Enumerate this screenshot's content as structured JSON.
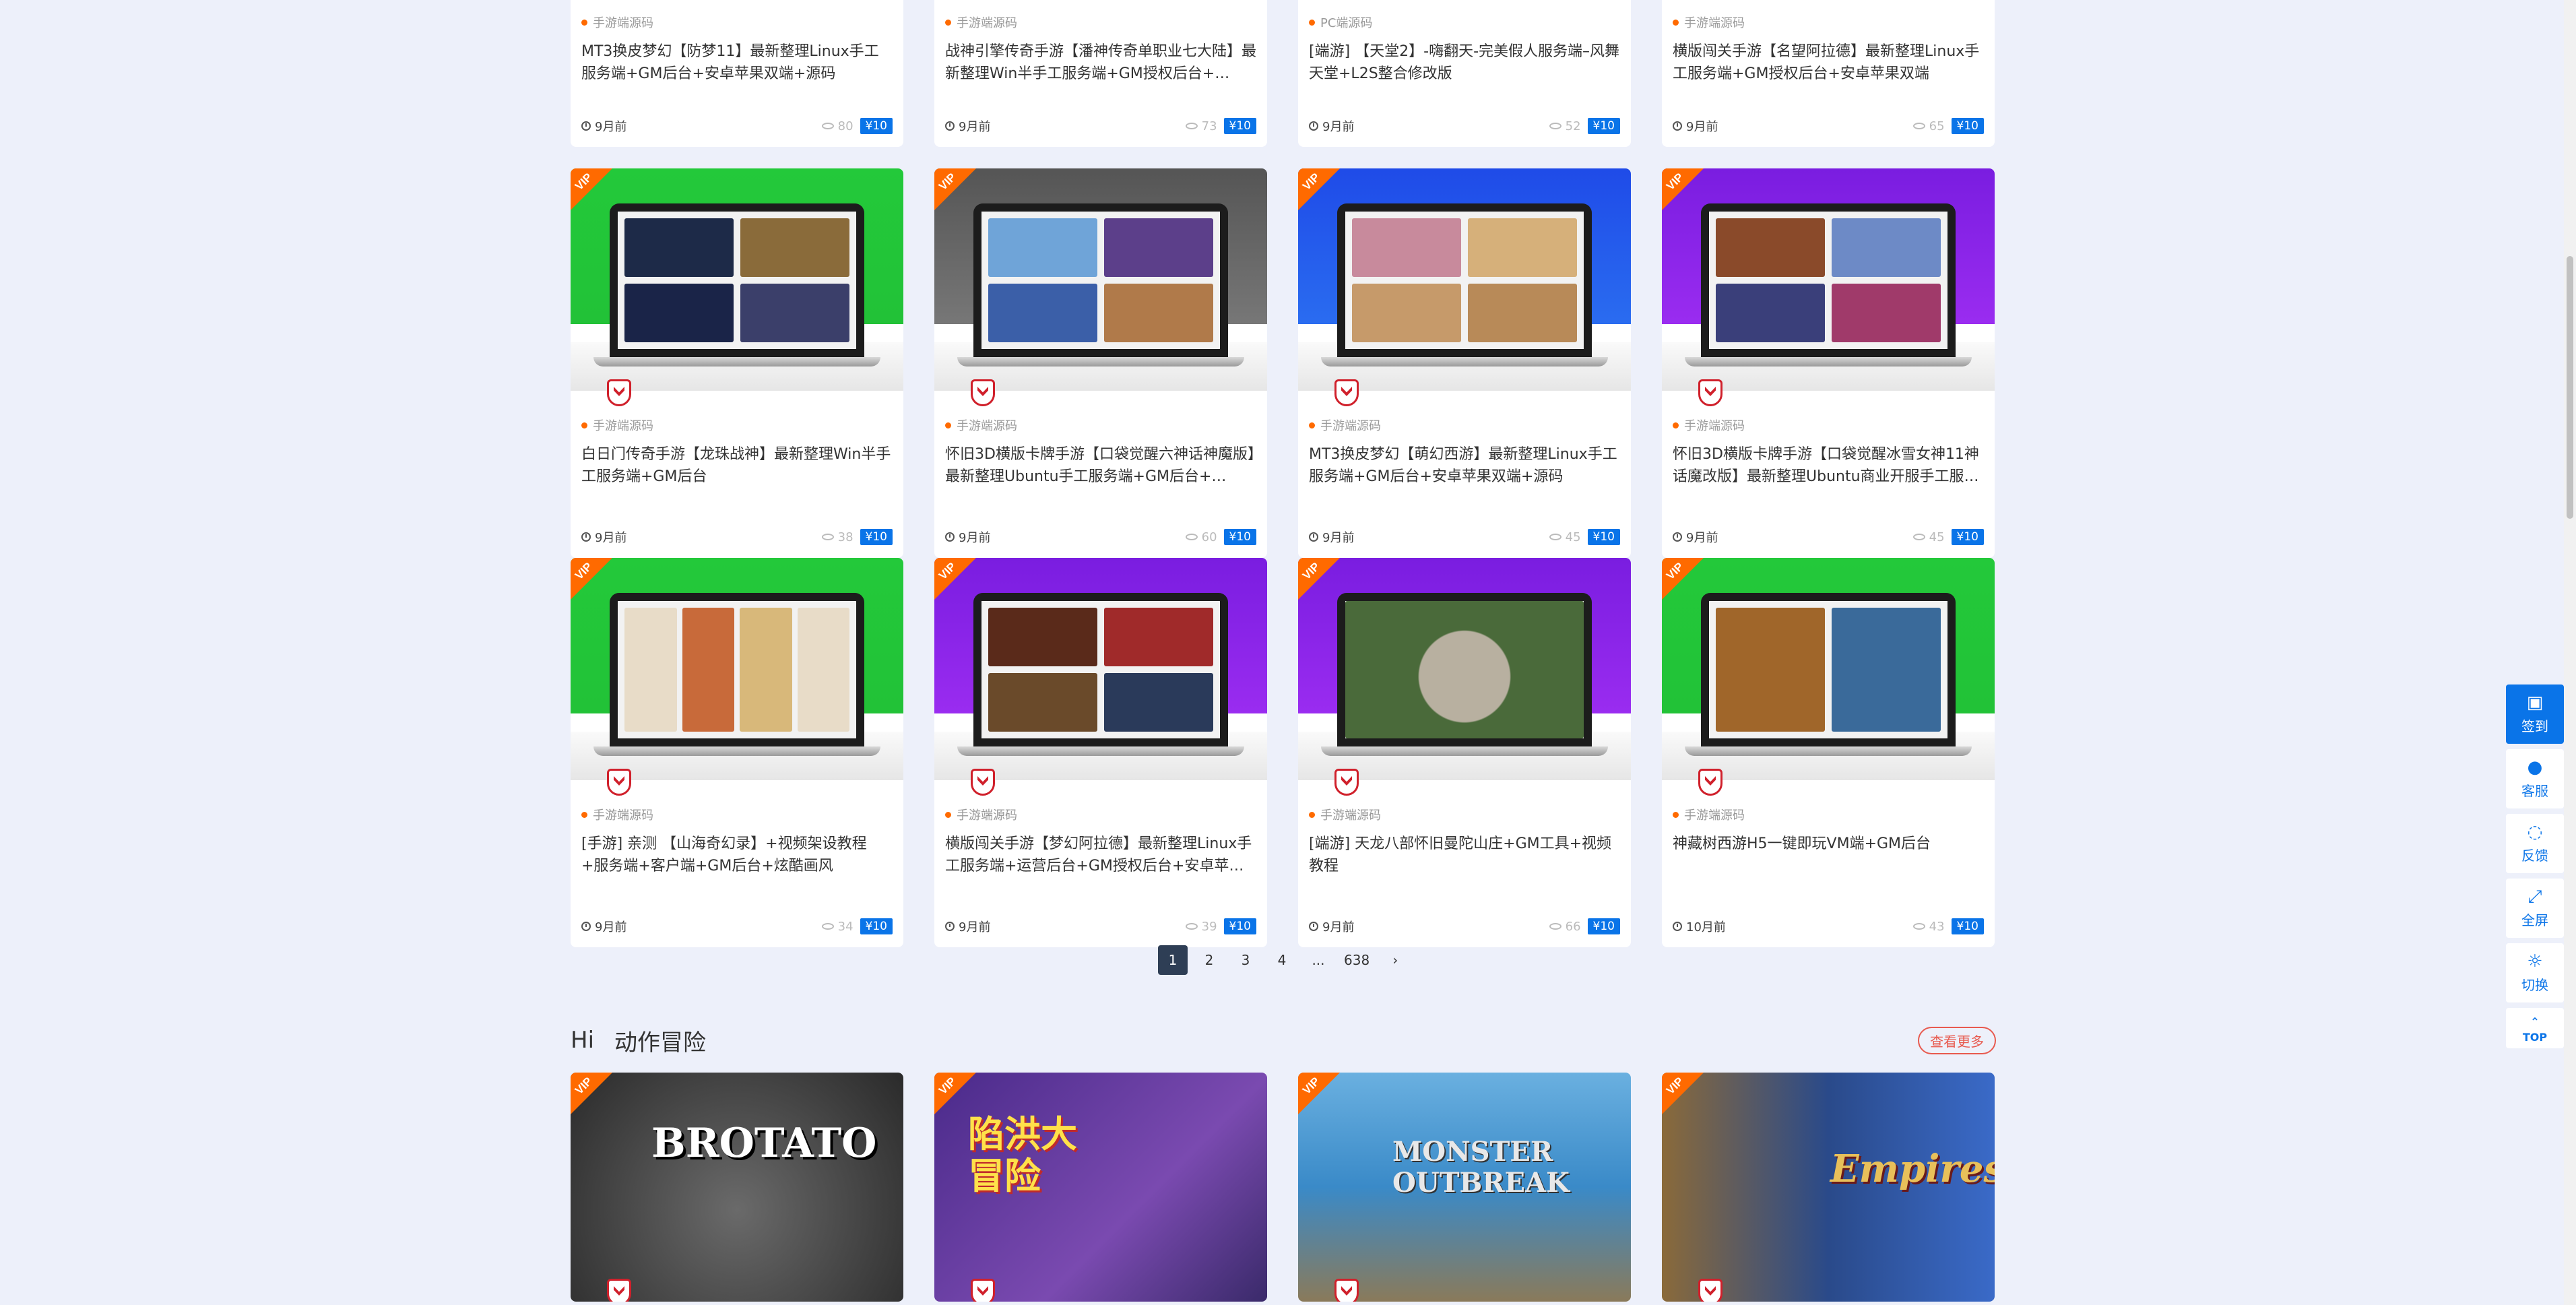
{
  "top_row": [
    {
      "category": "手游端源码",
      "title": "MT3换皮梦幻【防梦11】最新整理Linux手工服务端+GM后台+安卓苹果双端+源码",
      "time": "9月前",
      "views": "80",
      "price": "¥10"
    },
    {
      "category": "手游端源码",
      "title": "战神引擎传奇手游【潘神传奇单职业七大陆】最新整理Win半手工服务端+GM授权后台+…",
      "time": "9月前",
      "views": "73",
      "price": "¥10"
    },
    {
      "category": "PC端源码",
      "title": "[端游] 【天堂2】-嗨翻天-完美假人服务端–风舞天堂+L2S整合修改版",
      "time": "9月前",
      "views": "52",
      "price": "¥10"
    },
    {
      "category": "手游端源码",
      "title": "横版闯关手游【名望阿拉德】最新整理Linux手工服务端+GM授权后台+安卓苹果双端",
      "time": "9月前",
      "views": "65",
      "price": "¥10"
    }
  ],
  "row2": [
    {
      "category": "手游端源码",
      "title": "白日门传奇手游【龙珠战神】最新整理Win半手工服务端+GM后台",
      "time": "9月前",
      "views": "38",
      "price": "¥10",
      "vip": "VIP"
    },
    {
      "category": "手游端源码",
      "title": "怀旧3D横版卡牌手游【口袋觉醒六神话神魔版】最新整理Ubuntu手工服务端+GM后台+…",
      "time": "9月前",
      "views": "60",
      "price": "¥10",
      "vip": "VIP"
    },
    {
      "category": "手游端源码",
      "title": "MT3换皮梦幻【萌幻西游】最新整理Linux手工服务端+GM后台+安卓苹果双端+源码",
      "time": "9月前",
      "views": "45",
      "price": "¥10",
      "vip": "VIP"
    },
    {
      "category": "手游端源码",
      "title": "怀旧3D横版卡牌手游【口袋觉醒冰雪女神11神话魔改版】最新整理Ubuntu商业开服手工服…",
      "time": "9月前",
      "views": "45",
      "price": "¥10",
      "vip": "VIP"
    }
  ],
  "row3": [
    {
      "category": "手游端源码",
      "title": "[手游] 亲测 【山海奇幻录】+视频架设教程+服务端+客户端+GM后台+炫酷画风",
      "time": "9月前",
      "views": "34",
      "price": "¥10",
      "vip": "VIP"
    },
    {
      "category": "手游端源码",
      "title": "横版闯关手游【梦幻阿拉德】最新整理Linux手工服务端+运营后台+GM授权后台+安卓苹…",
      "time": "9月前",
      "views": "39",
      "price": "¥10",
      "vip": "VIP"
    },
    {
      "category": "手游端源码",
      "title": "[端游] 天龙八部怀旧曼陀山庄+GM工具+视频教程",
      "time": "9月前",
      "views": "66",
      "price": "¥10",
      "vip": "VIP"
    },
    {
      "category": "手游端源码",
      "title": "神藏树西游H5一键即玩VM端+GM后台",
      "time": "10月前",
      "views": "43",
      "price": "¥10",
      "vip": "VIP"
    }
  ],
  "pagination": {
    "pages": [
      "1",
      "2",
      "3",
      "4",
      "...",
      "638"
    ],
    "next": "›"
  },
  "section": {
    "hi": "Hi",
    "name": "动作冒险",
    "more": "查看更多"
  },
  "games": [
    {
      "vip": "VIP",
      "title": "BROTATO"
    },
    {
      "vip": "VIP",
      "title": "陷洪大冒险"
    },
    {
      "vip": "VIP",
      "title": "MONSTER OUTBREAK"
    },
    {
      "vip": "VIP",
      "title": "Empires"
    }
  ],
  "rail": {
    "signin": "签到",
    "service": "客服",
    "feedback": "反馈",
    "fullscreen": "全屏",
    "switch": "切换",
    "top": "TOP"
  },
  "colors": {
    "accent": "#0a74e8",
    "vip": "#ff6a00",
    "more": "#e85a4f",
    "page_active": "#2e3e55"
  }
}
